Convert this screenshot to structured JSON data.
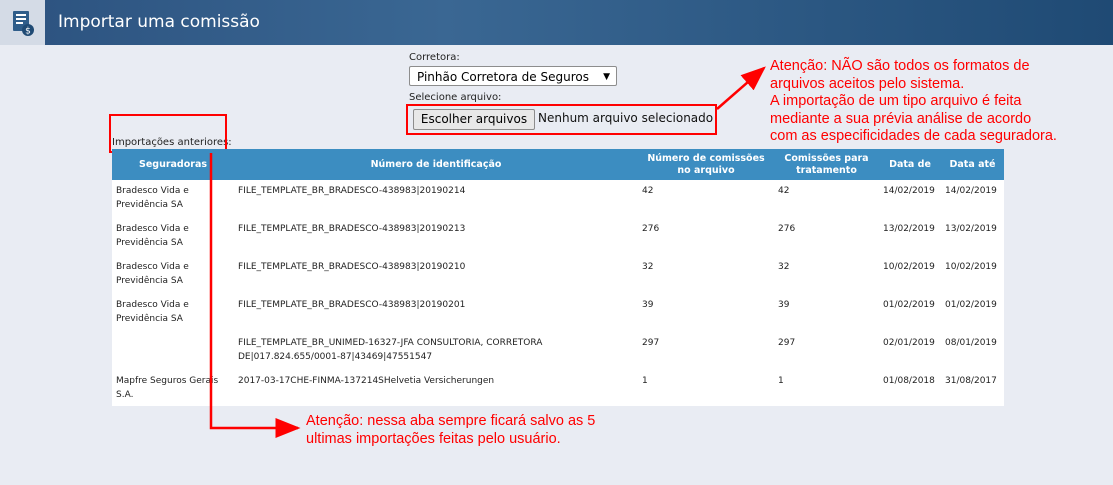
{
  "header": {
    "title": "Importar uma comissão",
    "icon": "document-money-icon"
  },
  "form": {
    "broker_label": "Corretora:",
    "broker_value": "Pinhão Corretora de Seguros",
    "file_label": "Selecione arquivo:",
    "file_button": "Escolher arquivos",
    "file_status": "Nenhum arquivo selecionado"
  },
  "previous_label": "Importações anteriores:",
  "table": {
    "headers": [
      "Seguradoras",
      "Número de identificação",
      "Número de comissões no arquivo",
      "Comissões para tratamento",
      "Data de",
      "Data até"
    ],
    "rows": [
      [
        "Bradesco Vida e Previdência SA",
        "FILE_TEMPLATE_BR_BRADESCO-438983|20190214",
        "42",
        "42",
        "14/02/2019",
        "14/02/2019"
      ],
      [
        "Bradesco Vida e Previdência SA",
        "FILE_TEMPLATE_BR_BRADESCO-438983|20190213",
        "276",
        "276",
        "13/02/2019",
        "13/02/2019"
      ],
      [
        "Bradesco Vida e Previdência SA",
        "FILE_TEMPLATE_BR_BRADESCO-438983|20190210",
        "32",
        "32",
        "10/02/2019",
        "10/02/2019"
      ],
      [
        "Bradesco Vida e Previdência SA",
        "FILE_TEMPLATE_BR_BRADESCO-438983|20190201",
        "39",
        "39",
        "01/02/2019",
        "01/02/2019"
      ],
      [
        "",
        "FILE_TEMPLATE_BR_UNIMED-16327-JFA CONSULTORIA, CORRETORA DE|017.824.655/0001-87|43469|47551547",
        "297",
        "297",
        "02/01/2019",
        "08/01/2019"
      ],
      [
        "Mapfre Seguros Gerais S.A.",
        "2017-03-17CHE-FINMA-137214SHelvetia Versicherungen",
        "1",
        "1",
        "01/08/2018",
        "31/08/2017"
      ]
    ]
  },
  "annotations": {
    "formats": [
      "Atenção: NÃO são todos os formatos de",
      "arquivos aceitos pelo sistema.",
      "A importação de um tipo arquivo é feita",
      "mediante a sua prévia análise de acordo",
      "com as especificidades de cada seguradora."
    ],
    "history": [
      "Atenção: nessa aba sempre ficará salvo as 5",
      "ultimas importações feitas pelo usuário."
    ],
    "color": "#ff0000"
  },
  "colors": {
    "header_bar": "#2c527f",
    "table_header": "#3c8dc1",
    "page_bg": "#e9ecf3"
  }
}
